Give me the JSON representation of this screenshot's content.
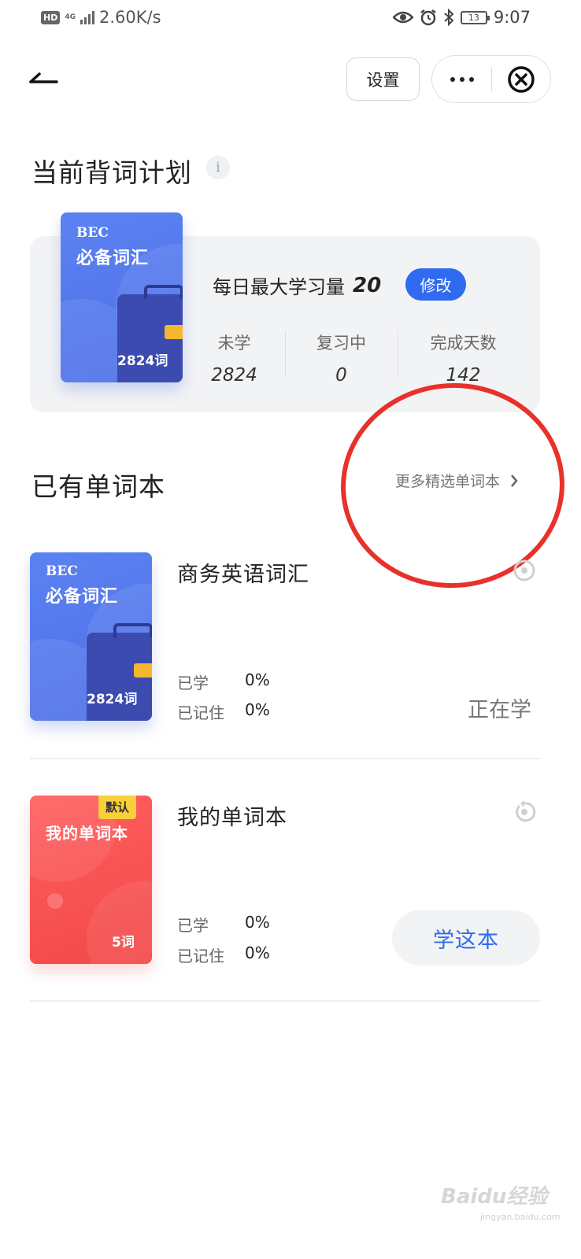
{
  "status_bar": {
    "hd": "HD",
    "network_type": "4G",
    "speed": "2.60K/s",
    "battery": "13",
    "time": "9:07",
    "icons": [
      "eye-icon",
      "alarm-icon",
      "bluetooth-icon",
      "battery-icon"
    ]
  },
  "nav": {
    "settings_label": "设置"
  },
  "plan": {
    "title": "当前背词计划",
    "info_icon": "i",
    "book": {
      "brand": "BEC",
      "name": "必备词汇",
      "word_count": "2824词"
    },
    "daily_label": "每日最大学习量",
    "daily_value": "20",
    "edit_label": "修改",
    "stats": [
      {
        "label": "未学",
        "value": "2824"
      },
      {
        "label": "复习中",
        "value": "0"
      },
      {
        "label": "完成天数",
        "value": "142"
      }
    ]
  },
  "books_section": {
    "title": "已有单词本",
    "more_link": "更多精选单词本"
  },
  "books": [
    {
      "cover_brand": "BEC",
      "cover_name": "必备词汇",
      "cover_count": "2824词",
      "title": "商务英语词汇",
      "learned_label": "已学",
      "learned_value": "0%",
      "memorized_label": "已记住",
      "memorized_value": "0%",
      "status": "正在学"
    },
    {
      "cover_tag": "默认",
      "cover_name": "我的单词本",
      "cover_count": "5词",
      "title": "我的单词本",
      "learned_label": "已学",
      "learned_value": "0%",
      "memorized_label": "已记住",
      "memorized_value": "0%",
      "action": "学这本"
    }
  ],
  "watermark": {
    "text": "Baidu经验",
    "sub": "jingyan.baidu.com"
  },
  "colors": {
    "accent": "#2f6af0",
    "highlight_circle": "#e8312a",
    "book_blue": "#5b82f2",
    "book_red": "#ff5a5a"
  }
}
